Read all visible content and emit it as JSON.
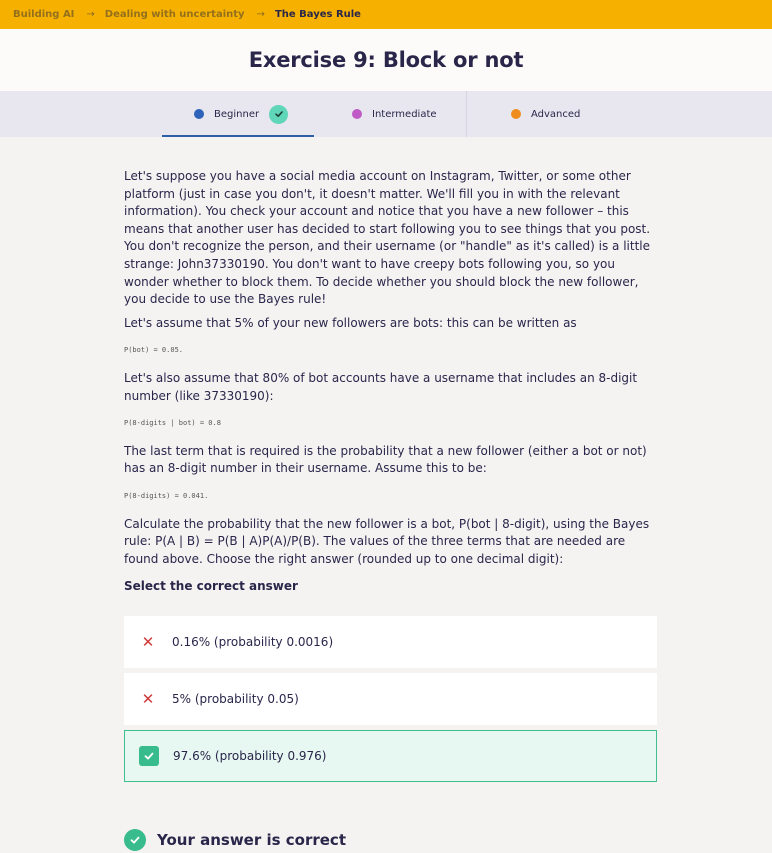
{
  "breadcrumb": {
    "items": [
      "Building AI",
      "Dealing with uncertainty"
    ],
    "separator": "→",
    "current": "The Bayes Rule"
  },
  "page_title": "Exercise 9: Block or not",
  "levels": [
    {
      "label": "Beginner",
      "color": "#2d63b8",
      "completed": true,
      "active": true
    },
    {
      "label": "Intermediate",
      "color": "#c05ac6",
      "completed": false,
      "active": false
    },
    {
      "label": "Advanced",
      "color": "#ee8c1e",
      "completed": false,
      "active": false
    }
  ],
  "content": {
    "p1": "Let's suppose you have a social media account on Instagram, Twitter, or some other platform (just in case you don't, it doesn't matter. We'll fill you in with the relevant information). You check your account and notice that you have a new follower – this means that another user has decided to start following you to see things that you post. You don't recognize the person, and their username (or \"handle\" as it's called) is a little strange: John37330190. You don't want to have creepy bots following you, so you wonder whether to block them. To decide whether you should block the new follower, you decide to use the Bayes rule!",
    "p2": "Let's assume that 5% of your new followers are bots: this can be written as",
    "code1": "P(bot) = 0.05.",
    "p3": "Let's also assume that 80% of bot accounts have a username that includes an 8-digit number (like 37330190):",
    "code2": "P(8-digits | bot) = 0.8",
    "p4": "The last term that is required is the probability that a new follower (either a bot or not) has an 8-digit number in their username. Assume this to be:",
    "code3": "P(8-digits) = 0.041.",
    "p5": "Calculate the probability that the new follower is a bot, P(bot | 8-digit), using the Bayes rule: P(A | B) = P(B | A)P(A)/P(B). The values of the three terms that are needed are found above. Choose the right answer (rounded up to one decimal digit):"
  },
  "quiz": {
    "prompt": "Select the correct answer",
    "options": [
      {
        "label": "0.16% (probability 0.0016)",
        "state": "wrong",
        "mark": "✕"
      },
      {
        "label": "5% (probability 0.05)",
        "state": "wrong",
        "mark": "✕"
      },
      {
        "label": "97.6% (probability 0.976)",
        "state": "correct",
        "mark": "check-icon"
      }
    ],
    "result": "Your answer is correct"
  },
  "colors": {
    "accent_yellow": "#f6b100",
    "navy": "#29264a",
    "success": "#38bb8d",
    "error": "#d03a3a"
  }
}
